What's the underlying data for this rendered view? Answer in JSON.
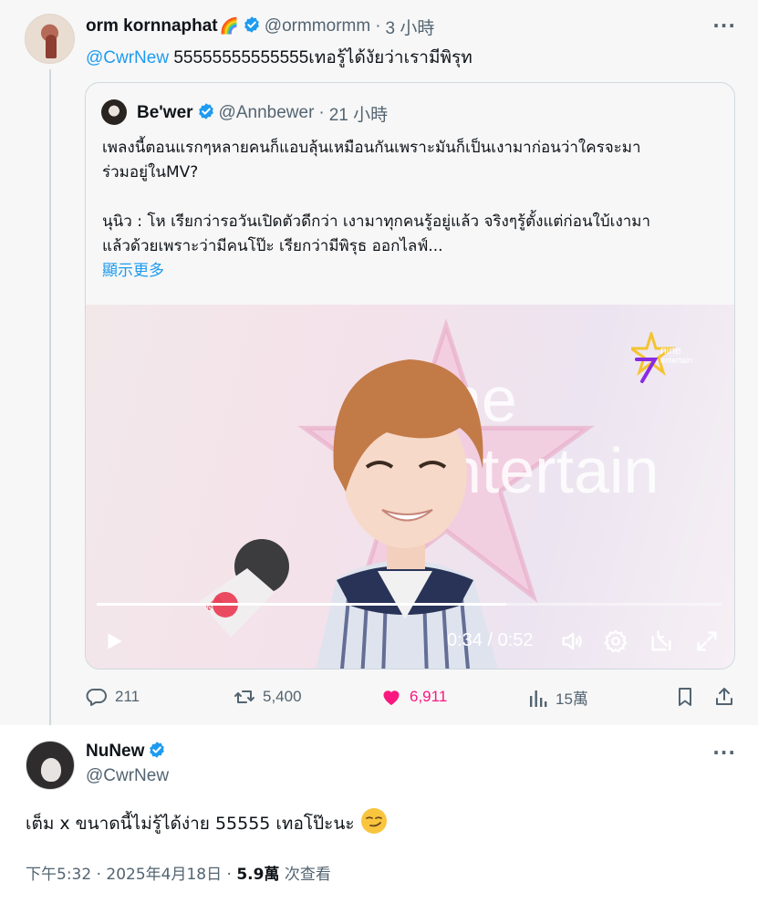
{
  "reply": {
    "author_name": "orm kornnaphat",
    "author_emoji": "🌈",
    "handle": "@ormmormm",
    "separator": "·",
    "time": "3 小時",
    "more": "···",
    "mention": "@CwrNew",
    "text": "55555555555555เทอรู้ได้งัยว่าเรามีพิรุท"
  },
  "quote": {
    "author_name": "Be'wer",
    "handle": "@Annbewer",
    "separator": "·",
    "time": "21 小時",
    "line1": "เพลงนี้ตอนแรกๆหลายคนก็แอบลุ้นเหมือนกันเพราะมันก็เป็นเงามาก่อนว่าใครจะมา",
    "line2": "ร่วมอยู่ในMV?",
    "line3": "นุนิว : โห เรียกว่ารอวันเปิดตัวดีกว่า เงามาทุกคนรู้อยู่แล้ว จริงๆรู้ตั้งแต่ก่อนใบ้เงามา",
    "line4": "แล้วด้วยเพราะว่ามีคนโป๊ะ เรียกว่ามีพิรุธ ออกไลฟ์...",
    "show_more": "顯示更多"
  },
  "video": {
    "brand_line1": "ne",
    "brand_line2": "ntertain",
    "logo_line1": "nine",
    "logo_line2": "entertain",
    "mic_text": "สรยุ",
    "time_readout": "0:34 / 0:52",
    "progress": 0.654
  },
  "actions": {
    "replies": "211",
    "reposts": "5,400",
    "likes": "6,911",
    "views": "15萬"
  },
  "main": {
    "author_name": "NuNew",
    "handle": "@CwrNew",
    "more": "···",
    "text": "เต็ม x ขนาดนี้ไม่รู้ได้ง่าย 55555 เทอโป๊ะนะ",
    "emoji": "smirking-face",
    "time": "下午5:32 · 2025年4月18日 · ",
    "views_count": "5.9萬",
    "views_label": " 次查看"
  },
  "colors": {
    "accent": "#1d9bf0",
    "like": "#f91880",
    "muted": "#536471"
  }
}
